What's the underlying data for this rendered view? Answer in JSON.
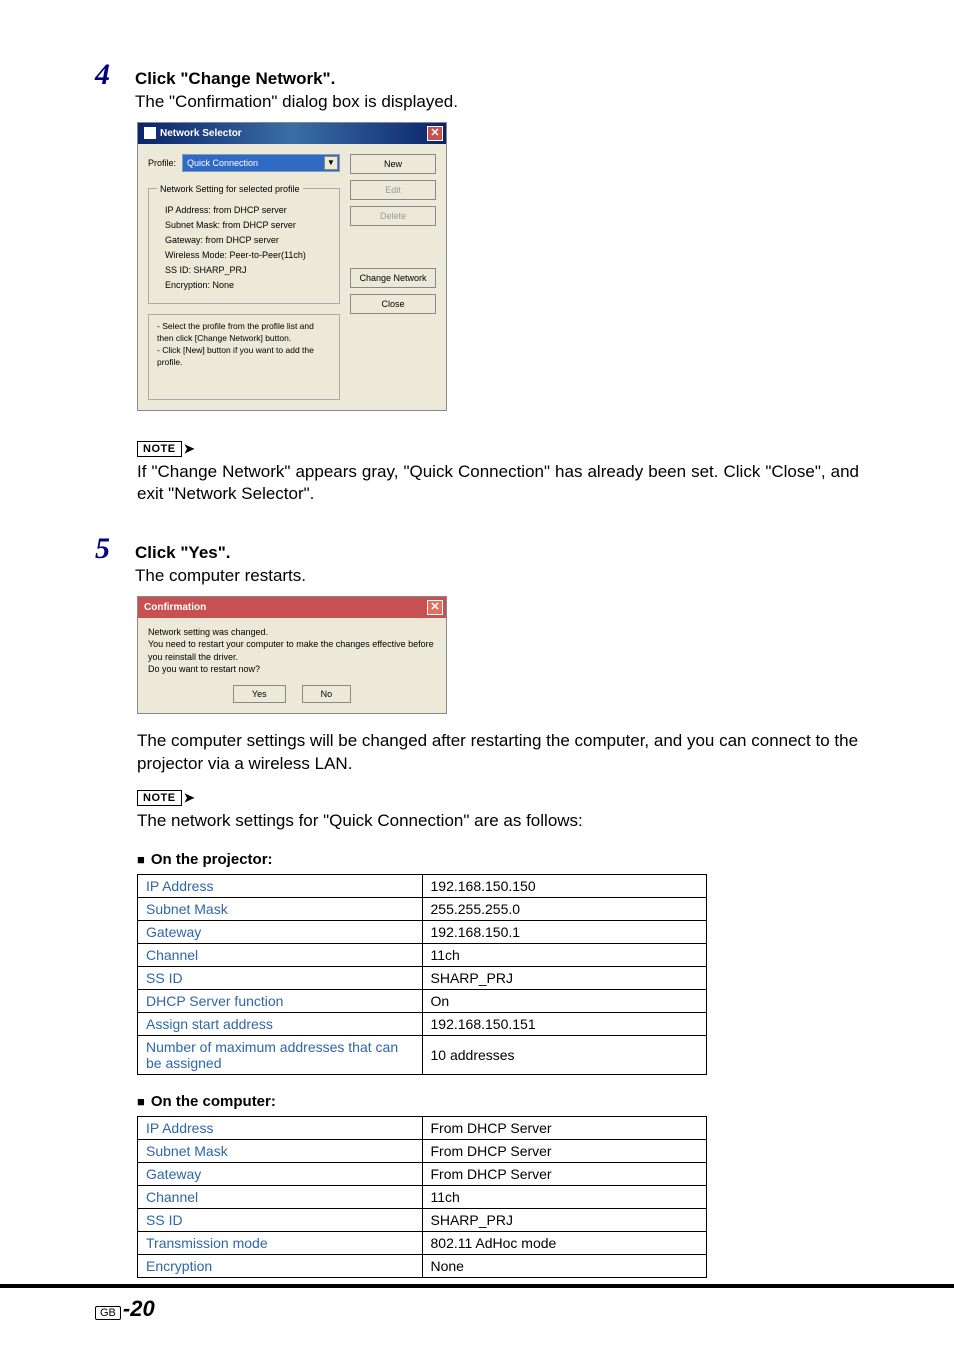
{
  "step4": {
    "num": "4",
    "title": "Click \"Change Network\".",
    "desc": "The \"Confirmation\" dialog box is displayed."
  },
  "ns": {
    "title": "Network Selector",
    "profile_label": "Profile:",
    "profile_value": "Quick Connection",
    "fs_legend": "Network Setting for selected profile",
    "settings": {
      "ip": "IP Address:  from DHCP server",
      "subnet": "Subnet Mask:  from DHCP server",
      "gateway": "Gateway:  from DHCP server",
      "wmode": "Wireless Mode:  Peer-to-Peer(11ch)",
      "ssid": "SS ID:  SHARP_PRJ",
      "enc": "Encryption:  None"
    },
    "tips_line1": "- Select the profile from the profile list and then click [Change Network] button.",
    "tips_line2": "- Click [New] button if you want to add the profile.",
    "buttons": {
      "new": "New",
      "edit": "Edit",
      "delete": "Delete",
      "change": "Change Network",
      "close": "Close"
    }
  },
  "note4": "If \"Change Network\" appears gray, \"Quick Connection\" has already been set. Click \"Close\", and exit \"Network Selector\".",
  "step5": {
    "num": "5",
    "title": "Click \"Yes\".",
    "desc": "The computer restarts."
  },
  "conf": {
    "title": "Confirmation",
    "body": "Network setting was changed.\nYou need to restart your computer to make the changes effective before you reinstall the driver.\nDo you want to restart now?",
    "yes": "Yes",
    "no": "No"
  },
  "after_restart": "The computer settings will be changed after restarting the computer, and you can connect to the projector via a wireless LAN.",
  "note5_intro": "The network settings for \"Quick Connection\" are as follows:",
  "proj_head": "On the projector:",
  "comp_head": "On the computer:",
  "proj_table": [
    [
      "IP Address",
      "192.168.150.150"
    ],
    [
      "Subnet Mask",
      "255.255.255.0"
    ],
    [
      "Gateway",
      "192.168.150.1"
    ],
    [
      "Channel",
      "11ch"
    ],
    [
      "SS ID",
      "SHARP_PRJ"
    ],
    [
      "DHCP Server function",
      "On"
    ],
    [
      "Assign start address",
      "192.168.150.151"
    ]
  ],
  "proj_last_row": {
    "label": "Number of maximum addresses that can be assigned",
    "value": "10 addresses"
  },
  "comp_table": [
    [
      "IP Address",
      "From DHCP Server"
    ],
    [
      "Subnet Mask",
      "From DHCP Server"
    ],
    [
      "Gateway",
      "From DHCP Server"
    ],
    [
      "Channel",
      "11ch"
    ],
    [
      "SS ID",
      "SHARP_PRJ"
    ],
    [
      "Transmission mode",
      "802.11 AdHoc mode"
    ],
    [
      "Encryption",
      "None"
    ]
  ],
  "labels": {
    "note": "NOTE",
    "gb": "GB"
  },
  "page_number": "-20"
}
